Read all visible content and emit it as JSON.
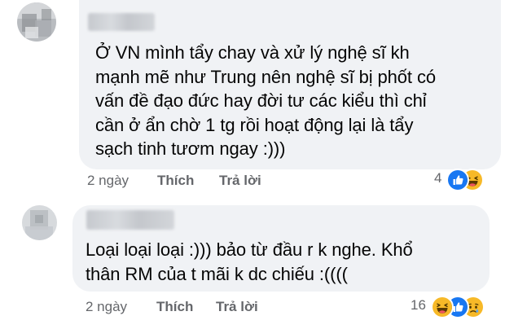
{
  "comments": [
    {
      "text": "Ở VN mình tẩy chay và xử lý nghệ sĩ kh\nmạnh mẽ như Trung nên nghệ sĩ bị phốt có\nvấn đề đạo đức hay đời tư các kiểu thì chỉ\ncần ở ẩn chờ 1 tg rồi hoạt động lại là tẩy\nsạch tinh tươm ngay :)))",
      "time": "2 ngày",
      "like_label": "Thích",
      "reply_label": "Trả lời",
      "reaction_count": "4",
      "reactions": [
        "like-icon",
        "haha-icon"
      ]
    },
    {
      "text": "Loại loại loại :))) bảo từ đầu r k nghe. Khổ\nthân RM của t mãi k dc chiếu :((((",
      "time": "2 ngày",
      "like_label": "Thích",
      "reply_label": "Trả lời",
      "reaction_count": "16",
      "reactions": [
        "haha-icon",
        "like-icon",
        "sad-icon"
      ]
    }
  ],
  "colors": {
    "bubble": "#f0f2f5",
    "meta_text": "#65676b",
    "like_blue": "#1877f2",
    "haha_yellow": "#f7b928"
  }
}
